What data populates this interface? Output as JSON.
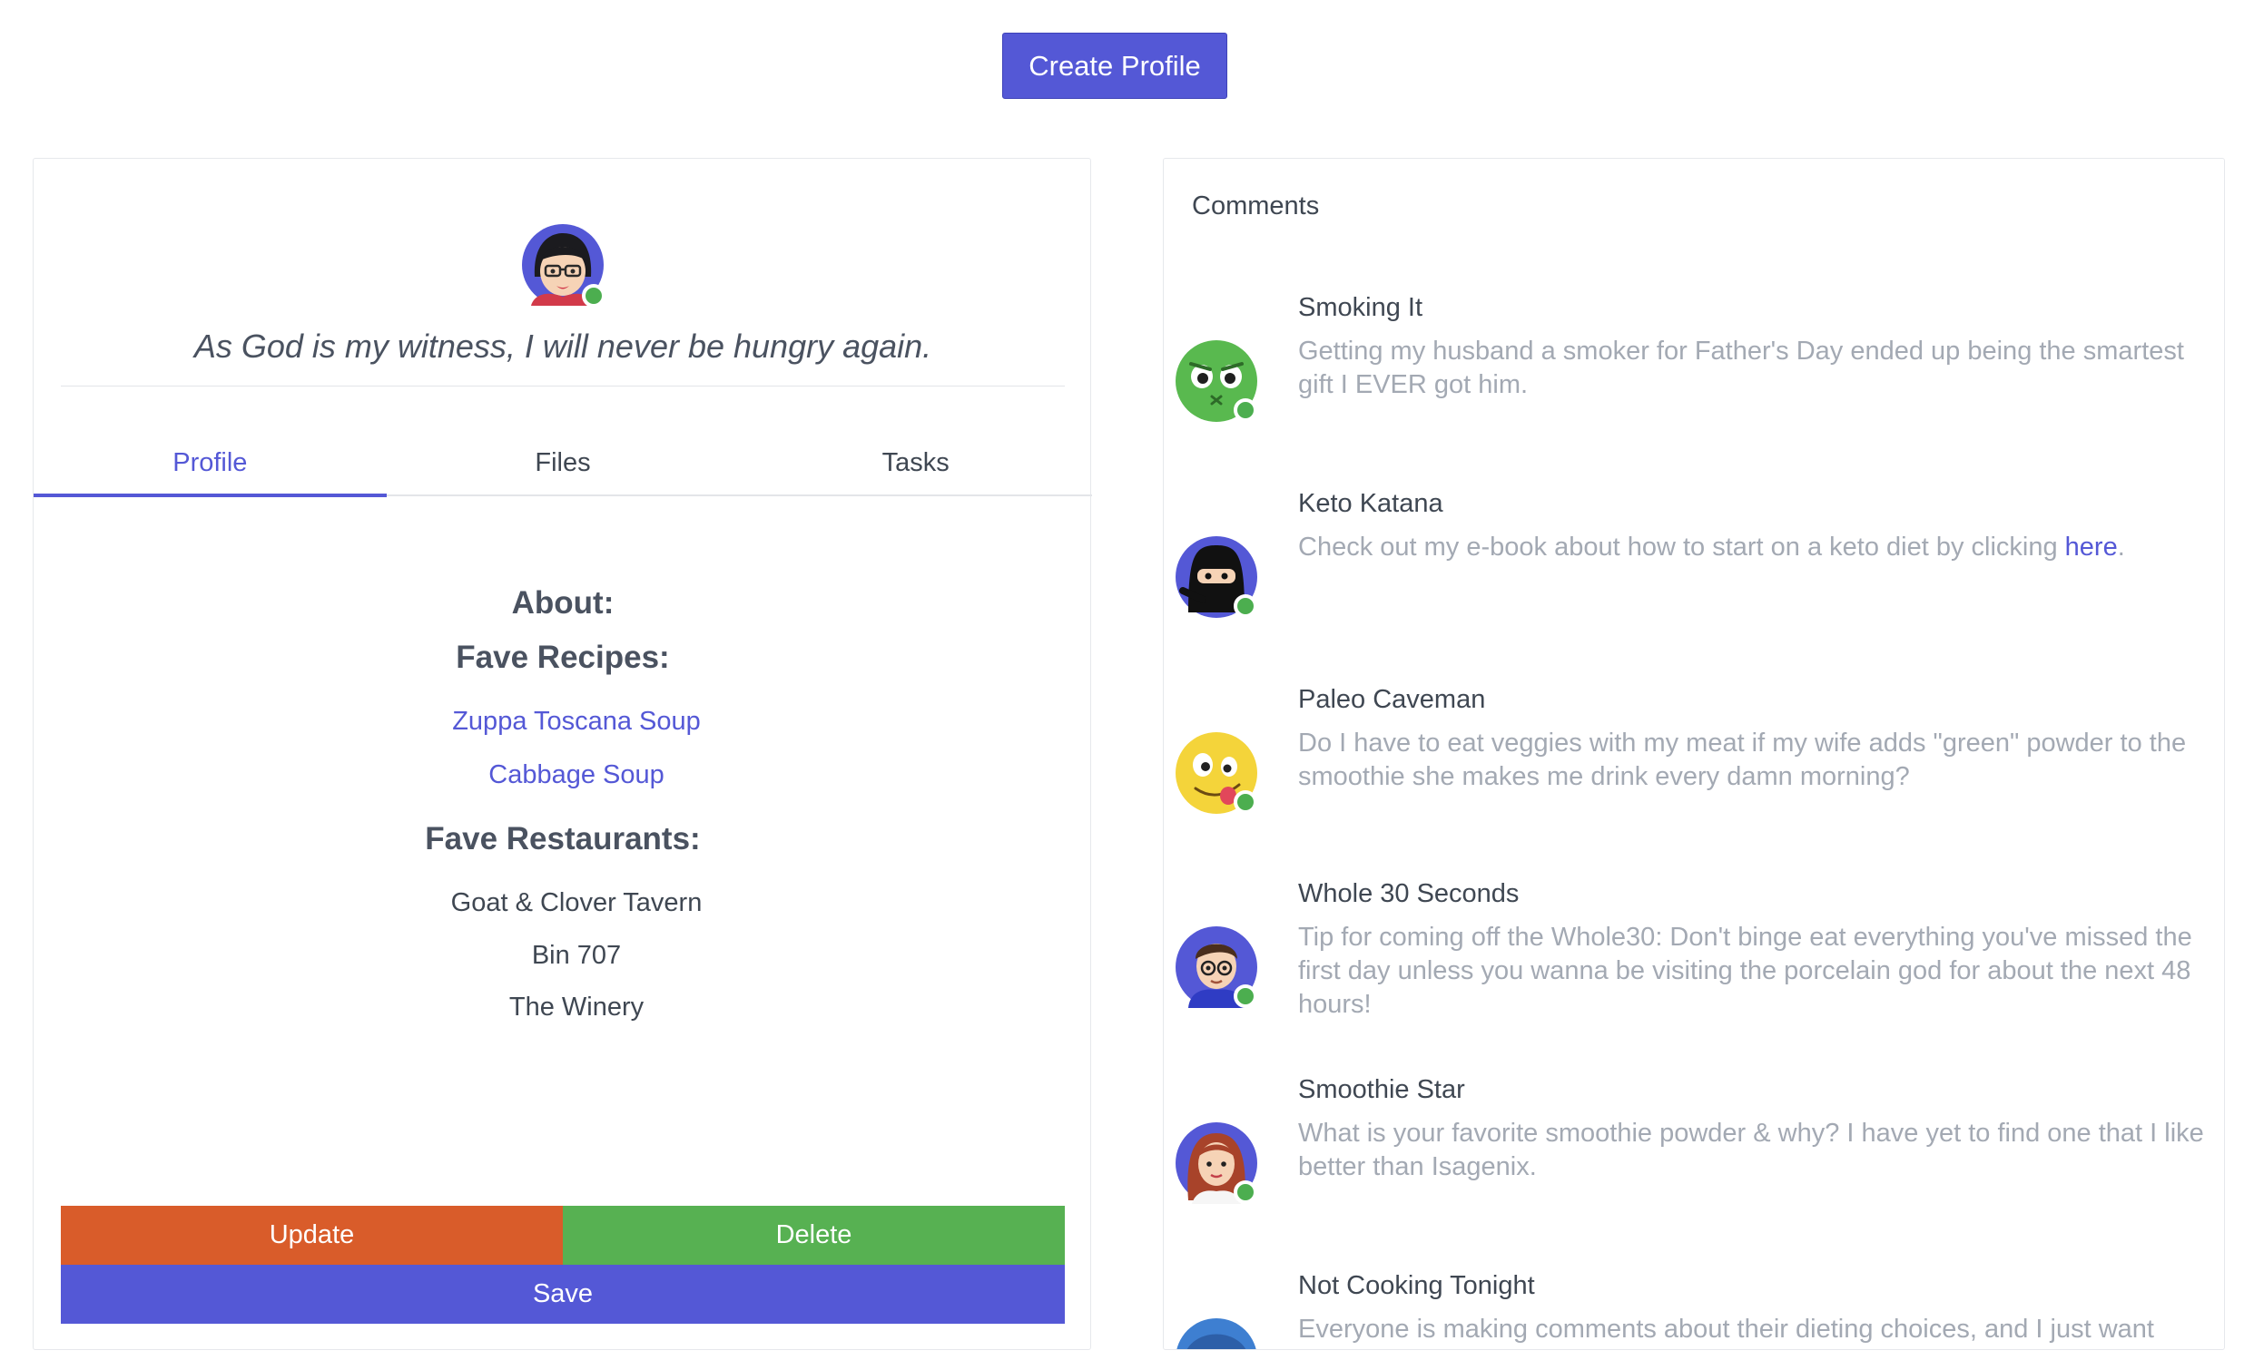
{
  "header": {
    "create_label": "Create Profile"
  },
  "profile": {
    "quote": "As God is my witness, I will never be hungry again.",
    "tabs": [
      "Profile",
      "Files",
      "Tasks"
    ],
    "about_label": "About:",
    "fave_recipes_label": "Fave Recipes:",
    "recipes": [
      "Zuppa Toscana Soup",
      "Cabbage Soup"
    ],
    "fave_restaurants_label": "Fave Restaurants:",
    "restaurants": [
      "Goat & Clover Tavern",
      "Bin 707",
      "The Winery"
    ],
    "buttons": {
      "update": "Update",
      "delete": "Delete",
      "save": "Save"
    }
  },
  "comments": {
    "title": "Comments",
    "items": [
      {
        "name": "Smoking It",
        "text": "Getting my husband a smoker for Father's Day ended up being the smartest gift I EVER got him."
      },
      {
        "name": "Keto Katana",
        "text": "Check out my e-book about how to start on a keto diet by clicking ",
        "link": "here",
        "after": "."
      },
      {
        "name": "Paleo Caveman",
        "text": "Do I have to eat veggies with my meat if my wife adds \"green\" powder to the smoothie she makes me drink every damn morning?"
      },
      {
        "name": "Whole 30 Seconds",
        "text": "Tip for coming off the Whole30: Don't binge eat everything you've missed the first day unless you wanna be visiting the porcelain god for about the next 48 hours!"
      },
      {
        "name": "Smoothie Star",
        "text": "What is your favorite smoothie powder & why? I have yet to find one that I like better than Isagenix."
      },
      {
        "name": "Not Cooking Tonight",
        "text": "Everyone is making comments about their dieting choices, and I just want"
      }
    ]
  },
  "colors": {
    "accent": "#5458d6",
    "update": "#d95c2a",
    "delete": "#57b152",
    "online": "#4cae4f"
  }
}
